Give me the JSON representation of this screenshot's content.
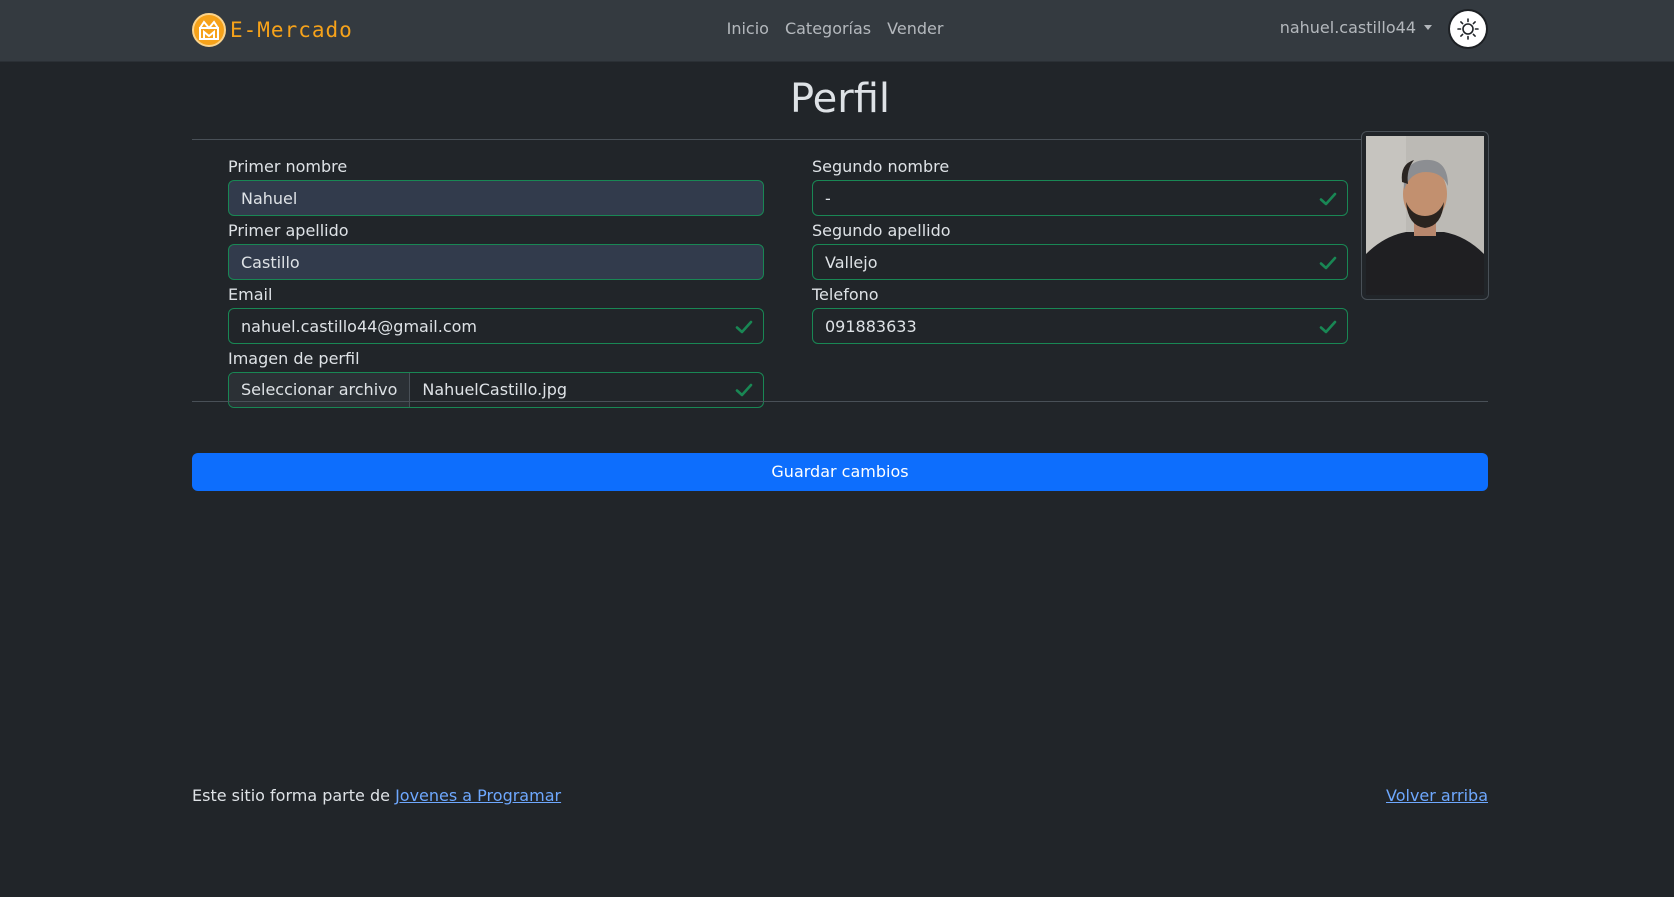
{
  "brand": {
    "name": "E-Mercado"
  },
  "nav": {
    "items": [
      "Inicio",
      "Categorías",
      "Vender"
    ]
  },
  "user": {
    "username": "nahuel.castillo44"
  },
  "page": {
    "title": "Perfil"
  },
  "form": {
    "first_name": {
      "label": "Primer nombre",
      "value": "Nahuel"
    },
    "second_name": {
      "label": "Segundo nombre",
      "value": "-"
    },
    "first_lastname": {
      "label": "Primer apellido",
      "value": "Castillo"
    },
    "second_lastname": {
      "label": "Segundo apellido",
      "value": "Vallejo"
    },
    "email": {
      "label": "Email",
      "value": "nahuel.castillo44@gmail.com"
    },
    "phone": {
      "label": "Telefono",
      "value": "091883633"
    },
    "image": {
      "label": "Imagen de perfil",
      "button": "Seleccionar archivo",
      "filename": "NahuelCastillo.jpg"
    },
    "save_label": "Guardar cambios"
  },
  "footer": {
    "prefix": "Este sitio forma parte de",
    "link": "Jovenes a Programar",
    "back_to_top": "Volver arriba"
  },
  "colors": {
    "background": "#212529",
    "navbar": "#343a40",
    "brand": "#f6a21a",
    "valid": "#198754",
    "primary": "#0d6efd",
    "link": "#6ea8fe"
  }
}
